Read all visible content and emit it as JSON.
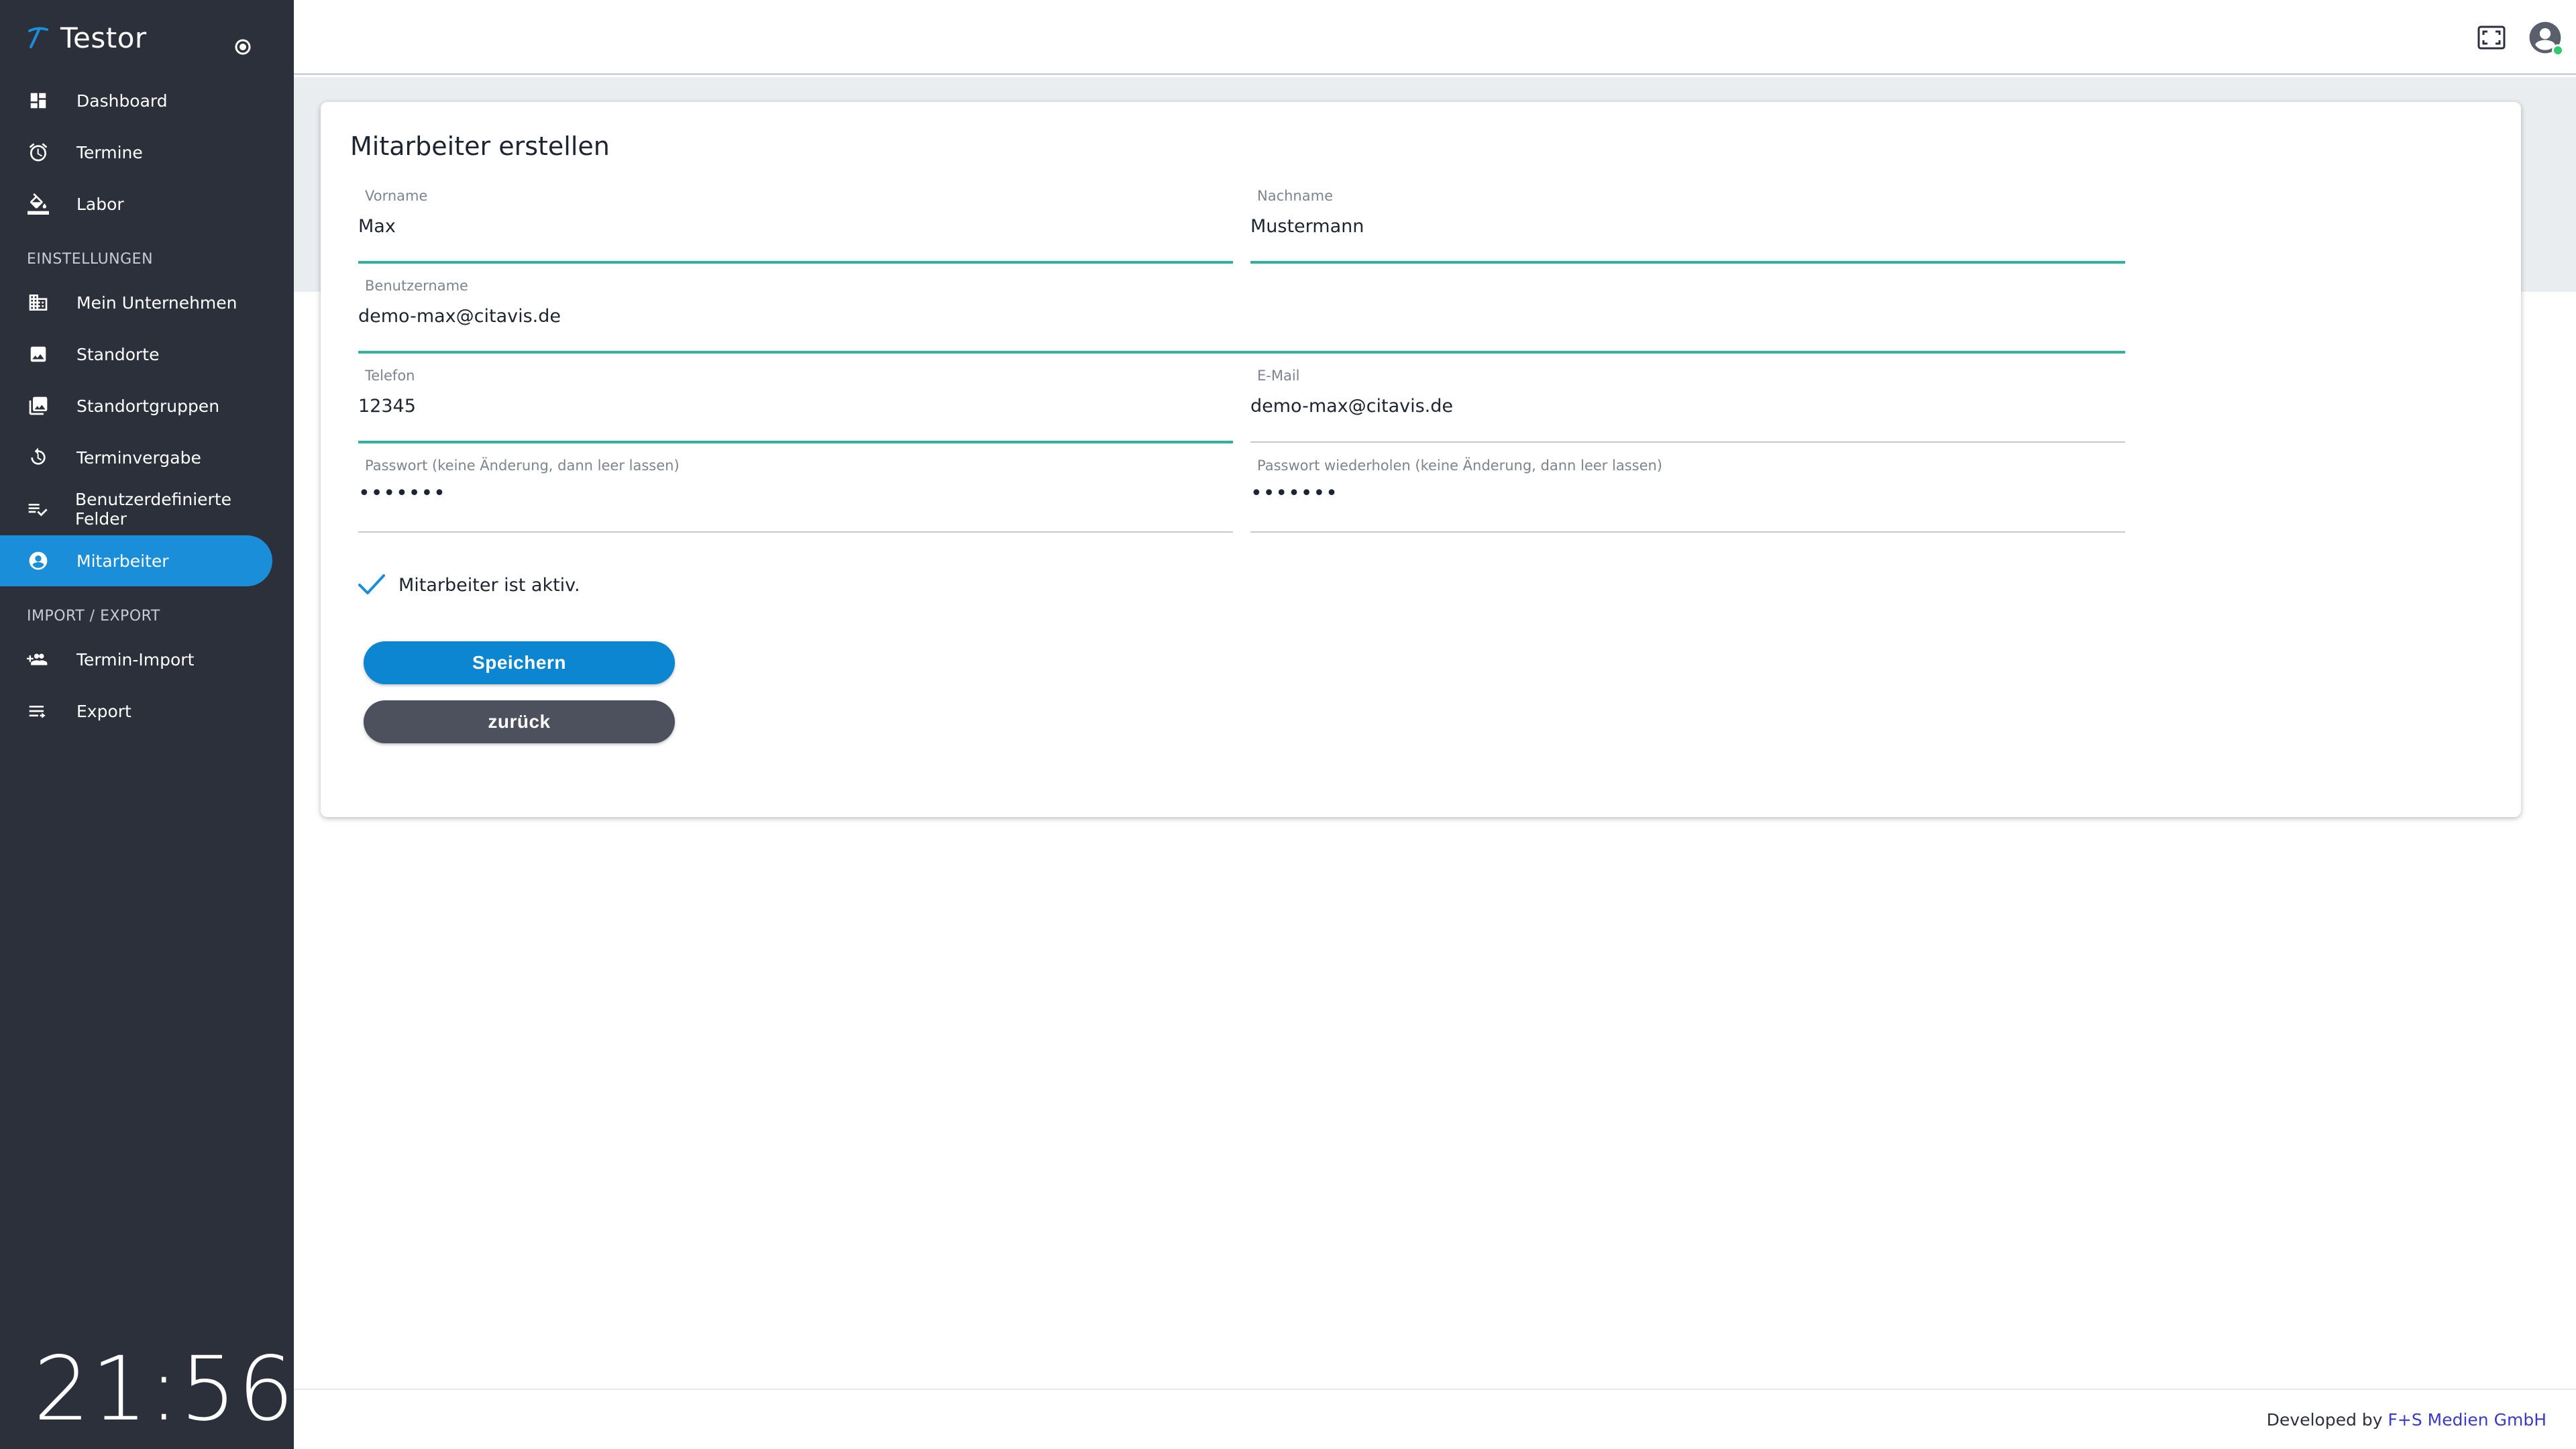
{
  "app": {
    "brand_name": "Testor",
    "accent_color": "#1a8ed8",
    "sidebar_color": "#2b303a",
    "clock": "21:56"
  },
  "sidebar": {
    "items_top": [
      {
        "label": "Dashboard",
        "icon": "dashboard-icon"
      },
      {
        "label": "Termine",
        "icon": "alarm-clock-icon"
      },
      {
        "label": "Labor",
        "icon": "paint-bucket-icon"
      }
    ],
    "section_settings": "EINSTELLUNGEN",
    "items_settings": [
      {
        "label": "Mein Unternehmen",
        "icon": "building-icon"
      },
      {
        "label": "Standorte",
        "icon": "image-icon"
      },
      {
        "label": "Standortgruppen",
        "icon": "image-stack-icon"
      },
      {
        "label": "Terminvergabe",
        "icon": "refresh-clock-icon"
      },
      {
        "label": "Benutzerdefinierte Felder",
        "icon": "checklist-icon"
      },
      {
        "label": "Mitarbeiter",
        "icon": "user-circle-icon",
        "active": true
      }
    ],
    "section_import": "IMPORT / EXPORT",
    "items_import": [
      {
        "label": "Termin-Import",
        "icon": "people-add-icon"
      },
      {
        "label": "Export",
        "icon": "list-export-icon"
      }
    ]
  },
  "form": {
    "title": "Mitarbeiter erstellen",
    "vorname": {
      "label": "Vorname",
      "value": "Max"
    },
    "nachname": {
      "label": "Nachname",
      "value": "Mustermann"
    },
    "benutzername": {
      "label": "Benutzername",
      "value": "demo-max@citavis.de"
    },
    "telefon": {
      "label": "Telefon",
      "value": "12345"
    },
    "email": {
      "label": "E-Mail",
      "value": "demo-max@citavis.de"
    },
    "passwort": {
      "label": "Passwort (keine Änderung, dann leer lassen)",
      "value": "•••••••"
    },
    "passwort2": {
      "label": "Passwort wiederholen (keine Änderung, dann leer lassen)",
      "value": "•••••••"
    },
    "active_label": "Mitarbeiter ist aktiv.",
    "save_label": "Speichern",
    "back_label": "zurück",
    "focus_color": "#2fb39c"
  },
  "footer": {
    "prefix": "Developed by",
    "company": "F+S Medien GmbH"
  }
}
